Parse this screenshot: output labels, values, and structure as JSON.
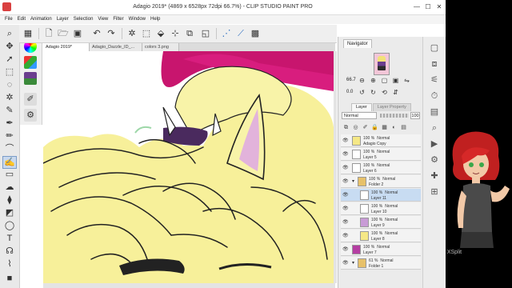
{
  "titlebar": {
    "title": "Adagio 2019* (4869 x 6528px 72dpi 66.7%) - CLIP STUDIO PAINT PRO",
    "minimize": "—",
    "maximize": "☐",
    "close": "✕"
  },
  "menu": [
    "File",
    "Edit",
    "Animation",
    "Layer",
    "Selection",
    "View",
    "Filter",
    "Window",
    "Help"
  ],
  "tabs": [
    {
      "label": "Adagio 2019*"
    },
    {
      "label": "Adagio_Dazzle_ID_..."
    },
    {
      "label": "colors 3.png"
    }
  ],
  "navigator": {
    "tab_label": "Navigator",
    "zoom": "66.7",
    "rotation": "0.0"
  },
  "layer_panel": {
    "tabs": [
      "Layer",
      "Layer Property"
    ],
    "blend_mode": "Normal",
    "opacity": "100"
  },
  "layers": [
    {
      "pct": "100 %",
      "mode": "Normal",
      "name": "Adagio Copy",
      "indent": 0,
      "thumb": "#f5e886",
      "selected": false,
      "folder": false
    },
    {
      "pct": "100 %",
      "mode": "Normal",
      "name": "Layer 5",
      "indent": 0,
      "thumb": "#ffffff",
      "selected": false,
      "folder": false
    },
    {
      "pct": "100 %",
      "mode": "Normal",
      "name": "Layer 6",
      "indent": 0,
      "thumb": "#ffffff",
      "selected": false,
      "folder": false
    },
    {
      "pct": "100 %",
      "mode": "Normal",
      "name": "Folder 2",
      "indent": 0,
      "thumb": "#e7c16a",
      "selected": false,
      "folder": true
    },
    {
      "pct": "100 %",
      "mode": "Normal",
      "name": "Layer 11",
      "indent": 10,
      "thumb": "#ffffff",
      "selected": true,
      "folder": false
    },
    {
      "pct": "100 %",
      "mode": "Normal",
      "name": "Layer 10",
      "indent": 10,
      "thumb": "#ffffff",
      "selected": false,
      "folder": false
    },
    {
      "pct": "100 %",
      "mode": "Normal",
      "name": "Layer 9",
      "indent": 10,
      "thumb": "#c89bd6",
      "selected": false,
      "folder": false
    },
    {
      "pct": "100 %",
      "mode": "Normal",
      "name": "Layer 8",
      "indent": 10,
      "thumb": "#f5e886",
      "selected": false,
      "folder": false
    },
    {
      "pct": "100 %",
      "mode": "Normal",
      "name": "Layer 7",
      "indent": 0,
      "thumb": "#b53ea2",
      "selected": false,
      "folder": false
    },
    {
      "pct": "61 %",
      "mode": "Normal",
      "name": "Folder 1",
      "indent": 0,
      "thumb": "#e7c16a",
      "selected": false,
      "folder": true
    }
  ],
  "overlay": {
    "watermark": "XSplit"
  },
  "colors": {
    "accent": "#c8dcf2",
    "canvas_magenta": "#c8156e",
    "hair_yellow": "#f7f09a",
    "ear_pink": "#e2b3db"
  }
}
